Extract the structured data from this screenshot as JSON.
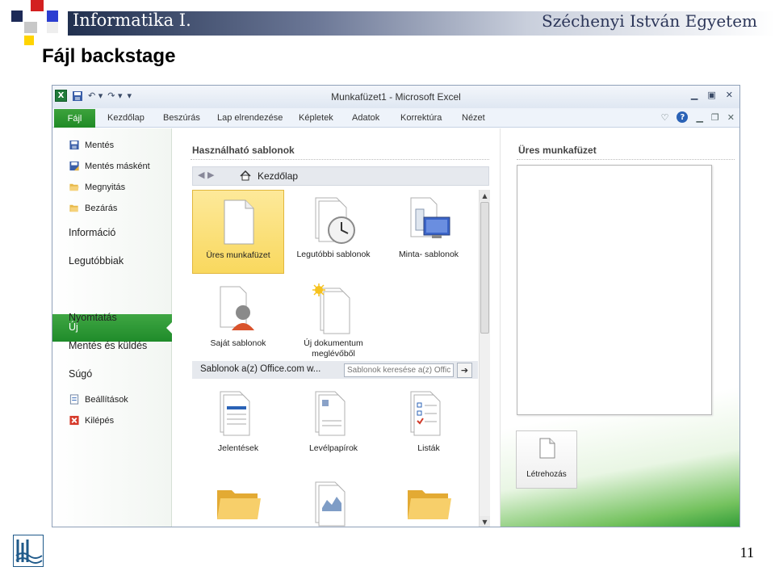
{
  "slide": {
    "course": "Informatika I.",
    "university": "Széchenyi István Egyetem",
    "title": "Fájl backstage",
    "page_number": "11"
  },
  "window": {
    "title": "Munkafüzet1  -  Microsoft Excel"
  },
  "ribbon": {
    "file_tab": "Fájl",
    "tabs": [
      "Kezdőlap",
      "Beszúrás",
      "Lap elrendezése",
      "Képletek",
      "Adatok",
      "Korrektúra",
      "Nézet"
    ]
  },
  "nav": {
    "commands": [
      {
        "label": "Mentés",
        "icon": "save-icon"
      },
      {
        "label": "Mentés másként",
        "icon": "save-as-icon"
      },
      {
        "label": "Megnyitás",
        "icon": "open-folder-icon"
      },
      {
        "label": "Bezárás",
        "icon": "close-folder-icon"
      }
    ],
    "items": [
      "Információ",
      "Legutóbbiak",
      "Új",
      "Nyomtatás",
      "Mentés és küldés",
      "Súgó"
    ],
    "bottom_commands": [
      {
        "label": "Beállítások",
        "icon": "options-icon"
      },
      {
        "label": "Kilépés",
        "icon": "exit-icon"
      }
    ],
    "selected": "Új"
  },
  "templates": {
    "heading": "Használható sablonok",
    "breadcrumb": "Kezdőlap",
    "tiles": [
      {
        "label": "Üres munkafüzet",
        "icon": "blank-workbook-icon",
        "selected": true
      },
      {
        "label": "Legutóbbi sablonok",
        "icon": "recent-templates-icon"
      },
      {
        "label": "Minta- sablonok",
        "icon": "sample-templates-icon"
      },
      {
        "label": "Saját sablonok",
        "icon": "my-templates-icon"
      },
      {
        "label": "Új dokumentum meglévőből",
        "icon": "new-from-existing-icon"
      }
    ],
    "office_section": "Sablonok a(z) Office.com w...",
    "search_placeholder": "Sablonok keresése a(z) Office",
    "office_tiles": [
      {
        "label": "Jelentések",
        "icon": "reports-icon"
      },
      {
        "label": "Levélpapírok",
        "icon": "letterhead-icon"
      },
      {
        "label": "Listák",
        "icon": "lists-icon"
      },
      {
        "label": "",
        "icon": "folder-icon"
      },
      {
        "label": "",
        "icon": "document-chart-icon"
      },
      {
        "label": "",
        "icon": "folder-icon"
      }
    ]
  },
  "preview": {
    "title": "Üres munkafüzet",
    "create_label": "Létrehozás"
  },
  "colors": {
    "file_tab": "#1f8a26",
    "selected_tile": "#f9d85e",
    "header_dark": "#21304f"
  }
}
